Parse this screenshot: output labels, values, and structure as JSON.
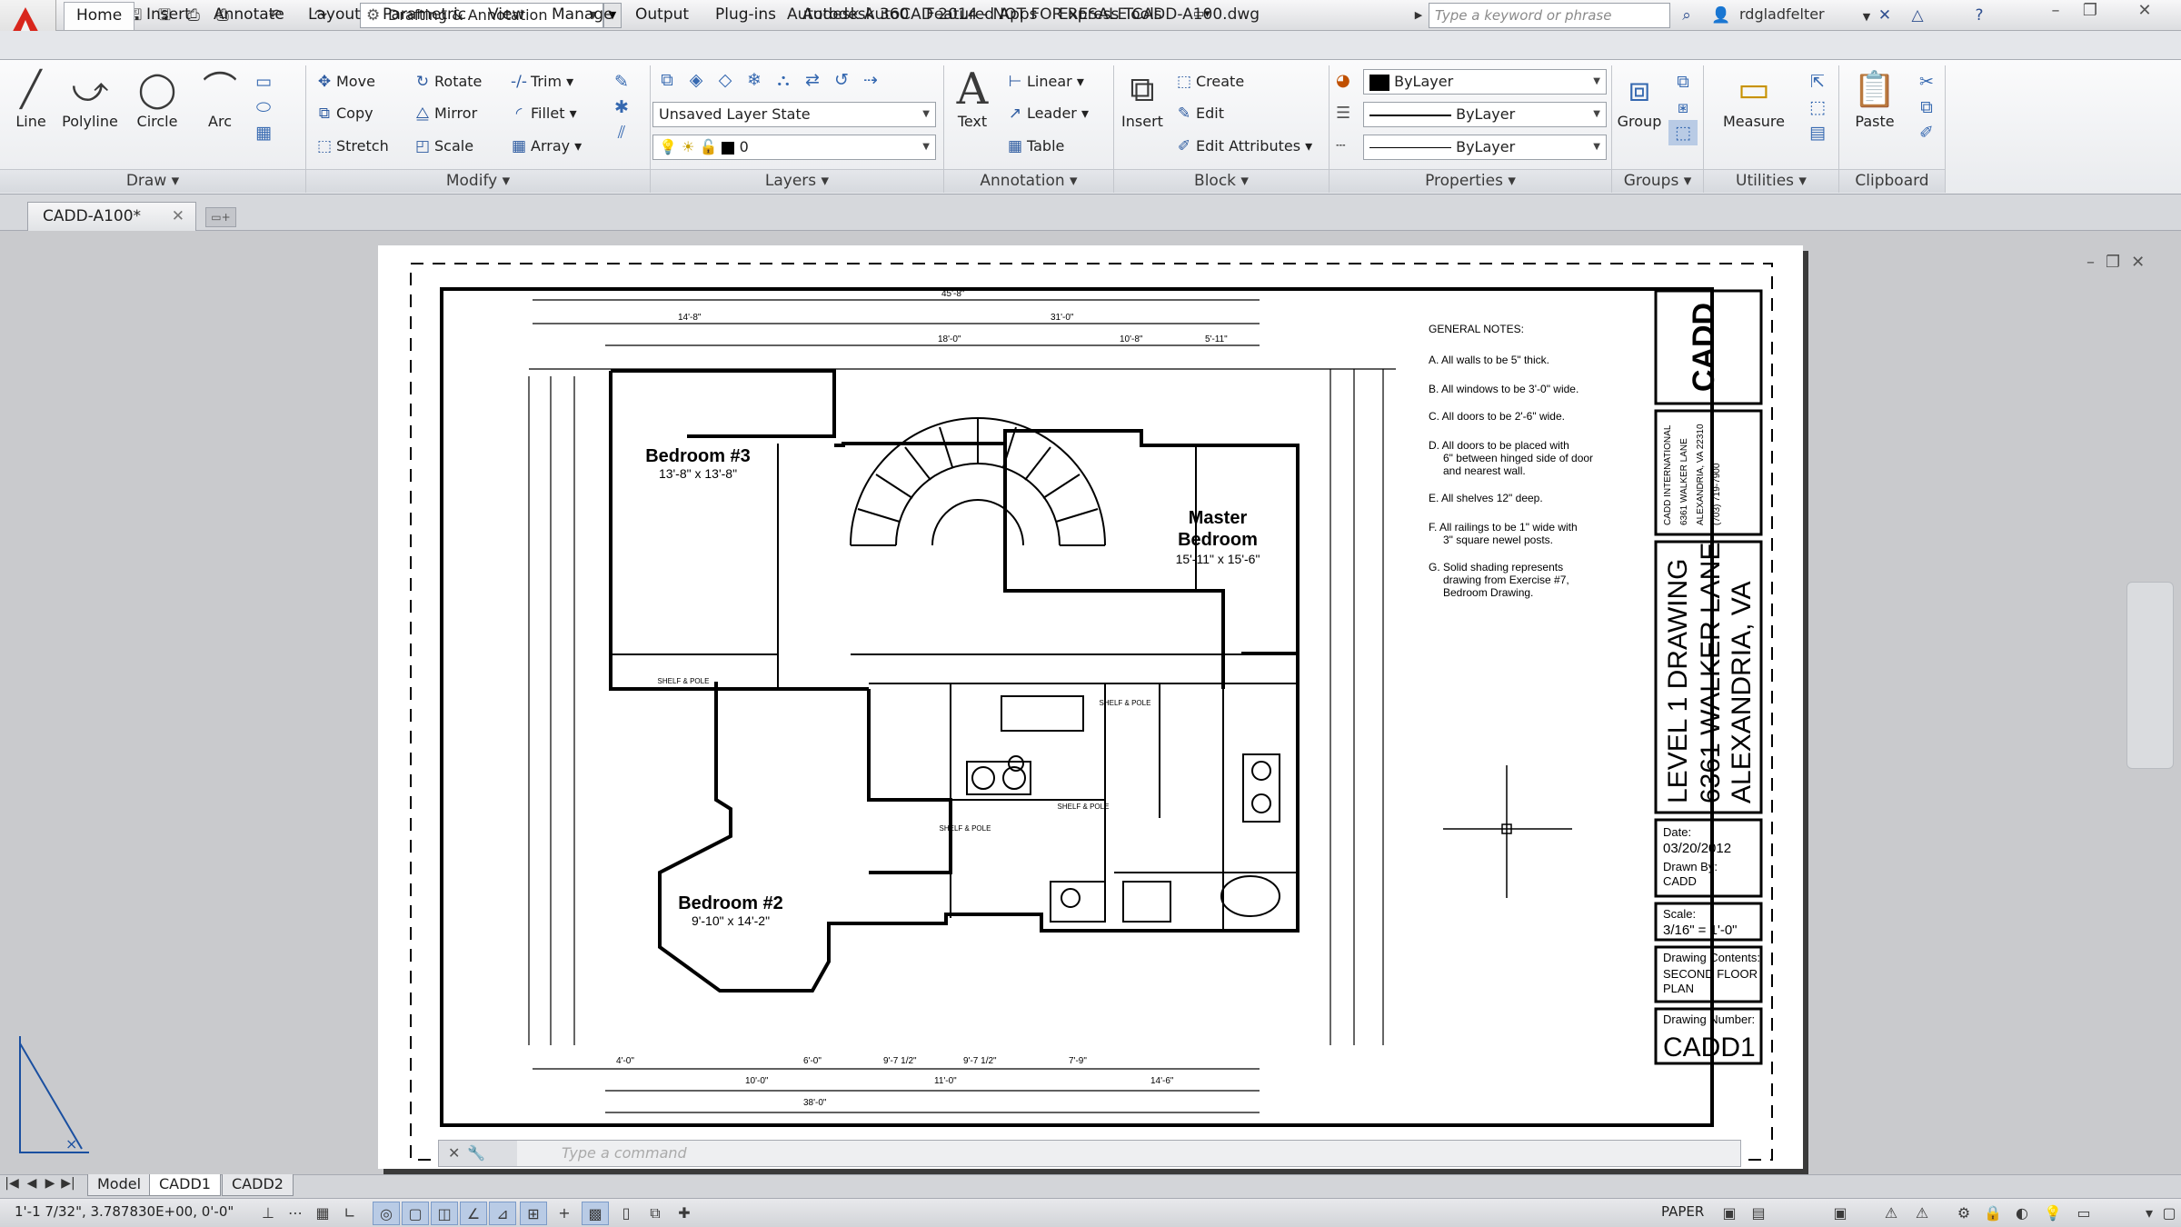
{
  "titlebar": {
    "workspace": "Drafting & Annotation",
    "title": "Autodesk AutoCAD 2014 - NOT FOR RESALE    CADD-A100.dwg",
    "search_placeholder": "Type a keyword or phrase",
    "username": "rdgladfelter"
  },
  "ribbon": {
    "tabs": [
      "Home",
      "Insert",
      "Annotate",
      "Layout",
      "Parametric",
      "View",
      "Manage",
      "Output",
      "Plug-ins",
      "Autodesk 360",
      "Featured Apps",
      "Express Tools"
    ],
    "active_tab": "Home",
    "draw": {
      "title": "Draw",
      "line": "Line",
      "polyline": "Polyline",
      "circle": "Circle",
      "arc": "Arc"
    },
    "modify": {
      "title": "Modify",
      "move": "Move",
      "rotate": "Rotate",
      "trim": "Trim",
      "copy": "Copy",
      "mirror": "Mirror",
      "fillet": "Fillet",
      "stretch": "Stretch",
      "scale": "Scale",
      "array": "Array"
    },
    "layers": {
      "title": "Layers",
      "layer_state": "Unsaved Layer State",
      "current_layer": "0"
    },
    "annotation": {
      "title": "Annotation",
      "text": "Text",
      "linear": "Linear",
      "leader": "Leader",
      "table": "Table"
    },
    "block": {
      "title": "Block",
      "insert": "Insert",
      "create": "Create",
      "edit": "Edit",
      "edit_attributes": "Edit Attributes"
    },
    "properties": {
      "title": "Properties",
      "color": "ByLayer",
      "linetype": "ByLayer",
      "lineweight": "ByLayer"
    },
    "groups": {
      "title": "Groups",
      "group": "Group"
    },
    "utilities": {
      "title": "Utilities",
      "measure": "Measure"
    },
    "clipboard": {
      "title": "Clipboard",
      "paste": "Paste"
    }
  },
  "document": {
    "tab": "CADD-A100*"
  },
  "drawing": {
    "rooms": [
      {
        "name": "Bedroom #3",
        "size": "13'-8\" x 13'-8\""
      },
      {
        "name": "Master Bedroom",
        "name_line1": "Master",
        "name_line2": "Bedroom",
        "size": "15'-11\" x 15'-6\""
      },
      {
        "name": "Bedroom #2",
        "size": "9'-10\" x 14'-2\""
      }
    ],
    "shelf_label": "SHELF & POLE",
    "general_notes": {
      "title": "GENERAL NOTES:",
      "items": [
        "A. All walls to be 5\" thick.",
        "B. All windows to be 3'-0\" wide.",
        "C. All doors to be 2'-6\" wide.",
        "D. All doors to be placed with",
        "6\" between hinged side of door",
        "and nearest wall.",
        "E. All shelves 12\" deep.",
        "F. All railings to be 1\" wide with",
        "3\" square newel posts.",
        "G. Solid shading represents",
        "drawing from Exercise #7,",
        "Bedroom Drawing."
      ]
    },
    "title_block": {
      "logo": "CADD",
      "company_lines": [
        "CADD INTERNATIONAL",
        "6361 WALKER LANE",
        "ALEXANDRIA, VA 22310",
        "(703) 719-7900"
      ],
      "project_lines": [
        "LEVEL 1 DRAWING",
        "6361 WALKER LANE",
        "ALEXANDRIA, VA"
      ],
      "date_label": "Date:",
      "date": "03/20/2012",
      "drawn_label": "Drawn By:",
      "drawn_by": "CADD",
      "scale_label": "Scale:",
      "scale": "3/16\" = 1'-0\"",
      "contents_label": "Drawing Contents:",
      "contents_lines": [
        "SECOND FLOOR",
        "PLAN"
      ],
      "number_label": "Drawing Number:",
      "number": "CADD1"
    },
    "dims_top": [
      "45'-8\"",
      "14'-8\"",
      "31'-0\"",
      "18'-0\"",
      "10'-8\"",
      "5'-11\""
    ],
    "dims_bottom": [
      "4'-0\"",
      "10'-0\"",
      "6'-0\"",
      "9'-7 1/2\"",
      "9'-7 1/2\"",
      "7'-9\"",
      "11'-0\"",
      "14'-6\"",
      "38'-0\""
    ]
  },
  "commandline": {
    "placeholder": "Type a command"
  },
  "layouts": {
    "tabs": [
      "Model",
      "CADD1",
      "CADD2"
    ],
    "active": "Model"
  },
  "status": {
    "coords": "1'-1 7/32\",  3.787830E+00, 0'-0\"",
    "space": "PAPER"
  }
}
